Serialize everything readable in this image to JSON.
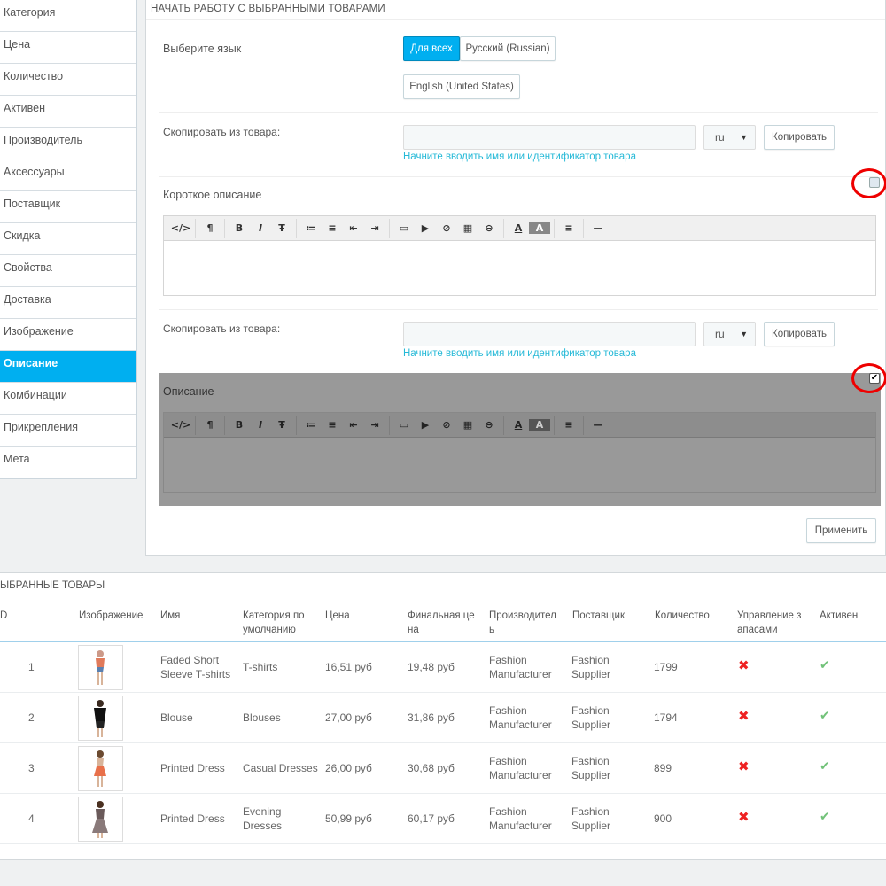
{
  "sidebar": {
    "items": [
      "Категория",
      "Цена",
      "Количество",
      "Активен",
      "Производитель",
      "Аксессуары",
      "Поставщик",
      "Скидка",
      "Свойства",
      "Доставка",
      "Изображение",
      "Описание",
      "Комбинации",
      "Прикрепления",
      "Мета"
    ],
    "active_index": 11
  },
  "panel": {
    "heading": "Начать работу с выбранными товарами",
    "language_label": "Выберите язык",
    "lang_buttons": [
      "Для всех",
      "Русский (Russian)",
      "English (United States)"
    ],
    "copy_label": "Скопировать из товара:",
    "copy_select_value": "ru",
    "copy_button": "Копировать",
    "copy_hint": "Начните вводить имя или идентификатор товара",
    "short_desc_label": "Короткое описание",
    "short_desc_checked": false,
    "desc_label": "Описание",
    "desc_checked": true,
    "apply_button": "Применить",
    "check_glyph": "✔"
  },
  "table": {
    "heading": "ыбранные товары",
    "headers": [
      "D",
      "Изображение",
      "Имя",
      "Категория по умолчанию",
      "Цена",
      "Финальная це на",
      "Производител ь",
      "Поставщик",
      "Количество",
      "Управление з апасами",
      "Активен"
    ],
    "rows": [
      {
        "id": "1",
        "name": "Faded Short Sleeve T-shirts",
        "category": "T-shirts",
        "price": "16,51 руб",
        "final": "19,48 руб",
        "manufacturer": "Fashion Manufacturer",
        "supplier": "Fashion Supplier",
        "qty": "1799"
      },
      {
        "id": "2",
        "name": "Blouse",
        "category": "Blouses",
        "price": "27,00 руб",
        "final": "31,86 руб",
        "manufacturer": "Fashion Manufacturer",
        "supplier": "Fashion Supplier",
        "qty": "1794"
      },
      {
        "id": "3",
        "name": "Printed Dress",
        "category": "Casual Dresses",
        "price": "26,00 руб",
        "final": "30,68 руб",
        "manufacturer": "Fashion Manufacturer",
        "supplier": "Fashion Supplier",
        "qty": "899"
      },
      {
        "id": "4",
        "name": "Printed Dress",
        "category": "Evening Dresses",
        "price": "50,99 руб",
        "final": "60,17 руб",
        "manufacturer": "Fashion Manufacturer",
        "supplier": "Fashion Supplier",
        "qty": "900"
      }
    ],
    "stock_mgmt_glyph": "✖",
    "active_glyph": "✔"
  },
  "toolbar": {
    "buttons": [
      "</>",
      "¶",
      "B",
      "I",
      "Ŧ",
      "≔",
      "≡",
      "⇤",
      "⇥",
      "▭",
      "▶",
      "⊘",
      "▦",
      "⊖",
      "A",
      "A",
      "≡",
      "—"
    ]
  },
  "colors": {
    "accent": "#00aff0",
    "hint": "#25b9d7",
    "error": "#ee2222",
    "success": "#72c279"
  }
}
